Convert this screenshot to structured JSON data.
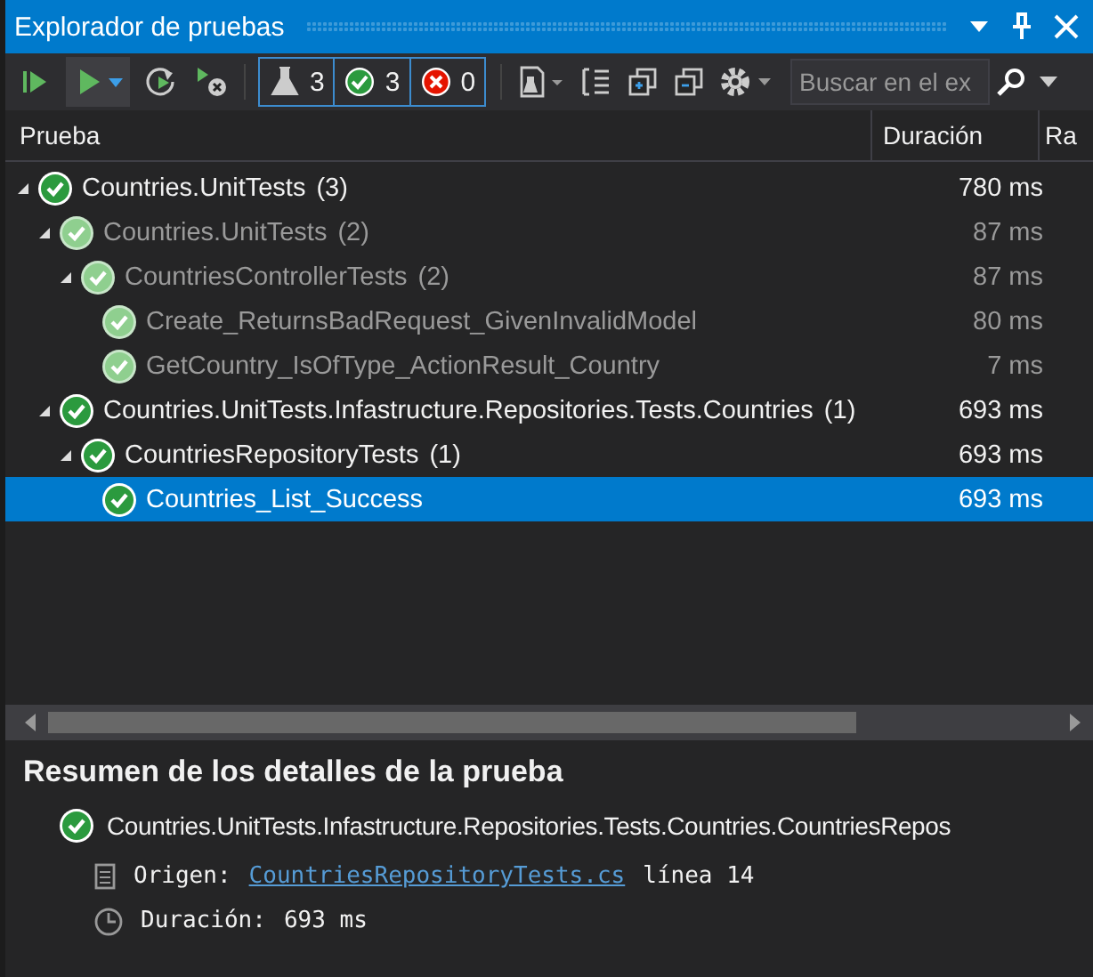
{
  "window": {
    "title": "Explorador de pruebas"
  },
  "toolbar": {
    "counters": [
      {
        "kind": "total",
        "count": "3"
      },
      {
        "kind": "passed",
        "count": "3"
      },
      {
        "kind": "failed",
        "count": "0"
      }
    ],
    "search": {
      "placeholder": "Buscar en el ex"
    }
  },
  "columns": [
    "Prueba",
    "Duración",
    "Ra"
  ],
  "tree": [
    {
      "name": "Countries.UnitTests",
      "count": "(3)",
      "duration": "780 ms",
      "expanded": true,
      "dimmed": false,
      "selected": false,
      "children": [
        {
          "name": "Countries.UnitTests",
          "count": "(2)",
          "duration": "87 ms",
          "expanded": true,
          "dimmed": true,
          "selected": false,
          "children": [
            {
              "name": "CountriesControllerTests",
              "count": "(2)",
              "duration": "87 ms",
              "expanded": true,
              "dimmed": true,
              "selected": false,
              "children": [
                {
                  "name": "Create_ReturnsBadRequest_GivenInvalidModel",
                  "duration": "80 ms",
                  "dimmed": true,
                  "selected": false
                },
                {
                  "name": "GetCountry_IsOfType_ActionResult_Country",
                  "duration": "7 ms",
                  "dimmed": true,
                  "selected": false
                }
              ]
            }
          ]
        },
        {
          "name": "Countries.UnitTests.Infastructure.Repositories.Tests.Countries",
          "count": "(1)",
          "duration": "693 ms",
          "expanded": true,
          "dimmed": false,
          "selected": false,
          "children": [
            {
              "name": "CountriesRepositoryTests",
              "count": "(1)",
              "duration": "693 ms",
              "expanded": true,
              "dimmed": false,
              "selected": false,
              "children": [
                {
                  "name": "Countries_List_Success",
                  "duration": "693 ms",
                  "dimmed": false,
                  "selected": true
                }
              ]
            }
          ]
        }
      ]
    }
  ],
  "details": {
    "title": "Resumen de los detalles de la prueba",
    "test": "Countries.UnitTests.Infastructure.Repositories.Tests.Countries.CountriesRepos",
    "source_label": "Origen:",
    "source_link": "CountriesRepositoryTests.cs",
    "line": "línea 14",
    "duration_label": "Duración:",
    "duration": "693 ms"
  }
}
